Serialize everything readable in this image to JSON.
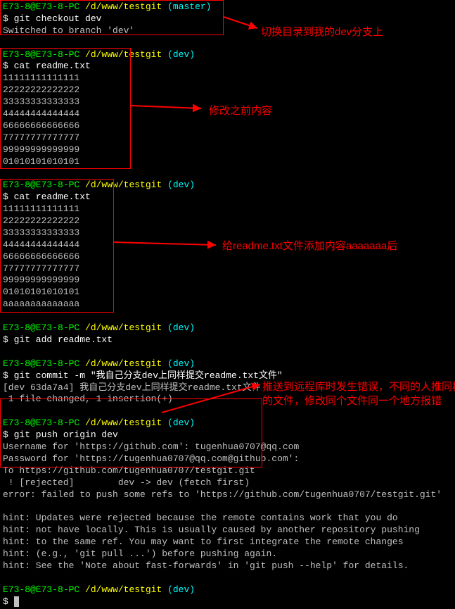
{
  "block1": {
    "prompt_user": "E73-8@E73-8-PC",
    "prompt_path": "/d/www/testgit",
    "prompt_branch": "(master)",
    "cmd": "$ git checkout dev",
    "out": "Switched to branch 'dev'"
  },
  "block2": {
    "prompt_user": "E73-8@E73-8-PC",
    "prompt_path": "/d/www/testgit",
    "prompt_branch": "(dev)",
    "cmd": "$ cat readme.txt",
    "content": [
      "11111111111111",
      "22222222222222",
      "33333333333333",
      "44444444444444",
      "66666666666666",
      "77777777777777",
      "99999999999999",
      "01010101010101"
    ]
  },
  "block3": {
    "prompt_user": "E73-8@E73-8-PC",
    "prompt_path": "/d/www/testgit",
    "prompt_branch": "(dev)",
    "cmd": "$ cat readme.txt",
    "content": [
      "11111111111111",
      "22222222222222",
      "33333333333333",
      "44444444444444",
      "66666666666666",
      "77777777777777",
      "99999999999999",
      "01010101010101",
      "aaaaaaaaaaaaaa"
    ]
  },
  "block4": {
    "prompt_user": "E73-8@E73-8-PC",
    "prompt_path": "/d/www/testgit",
    "prompt_branch": "(dev)",
    "cmd": "$ git add readme.txt"
  },
  "block5": {
    "prompt_user": "E73-8@E73-8-PC",
    "prompt_path": "/d/www/testgit",
    "prompt_branch": "(dev)",
    "cmd": "$ git commit -m \"我自己分支dev上同样提交readme.txt文件\"",
    "out1": "[dev 63da7a4] 我自己分支dev上同样提交readme.txt文件",
    "out2": " 1 file changed, 1 insertion(+)"
  },
  "block6": {
    "prompt_user": "E73-8@E73-8-PC",
    "prompt_path": "/d/www/testgit",
    "prompt_branch": "(dev)",
    "cmd": "$ git push origin dev",
    "out1": "Username for 'https://github.com': tugenhua0707@qq.com",
    "out2": "Password for 'https://tugenhua0707@qq.com@github.com':",
    "out3": "To https://github.com/tugenhua0707/testgit.git",
    "out4": " ! [rejected]        dev -> dev (fetch first)",
    "out5": "error: failed to push some refs to 'https://github.com/tugenhua0707/testgit.git'",
    "hint1": "hint: Updates were rejected because the remote contains work that you do",
    "hint2": "hint: not have locally. This is usually caused by another repository pushing",
    "hint3": "hint: to the same ref. You may want to first integrate the remote changes",
    "hint4": "hint: (e.g., 'git pull ...') before pushing again.",
    "hint5": "hint: See the 'Note about fast-forwards' in 'git push --help' for details."
  },
  "block7": {
    "prompt_user": "E73-8@E73-8-PC",
    "prompt_path": "/d/www/testgit",
    "prompt_branch": "(dev)",
    "cmd": "$"
  },
  "annotations": {
    "a1": "切换目录到我的dev分支上",
    "a2": "修改之前内容",
    "a3": "给readme.txt文件添加内容aaaaaaa后",
    "a4_line1": "推送到远程库时发生错误，不同的人推同样",
    "a4_line2": "的文件，修改同个文件同一个地方报错"
  }
}
